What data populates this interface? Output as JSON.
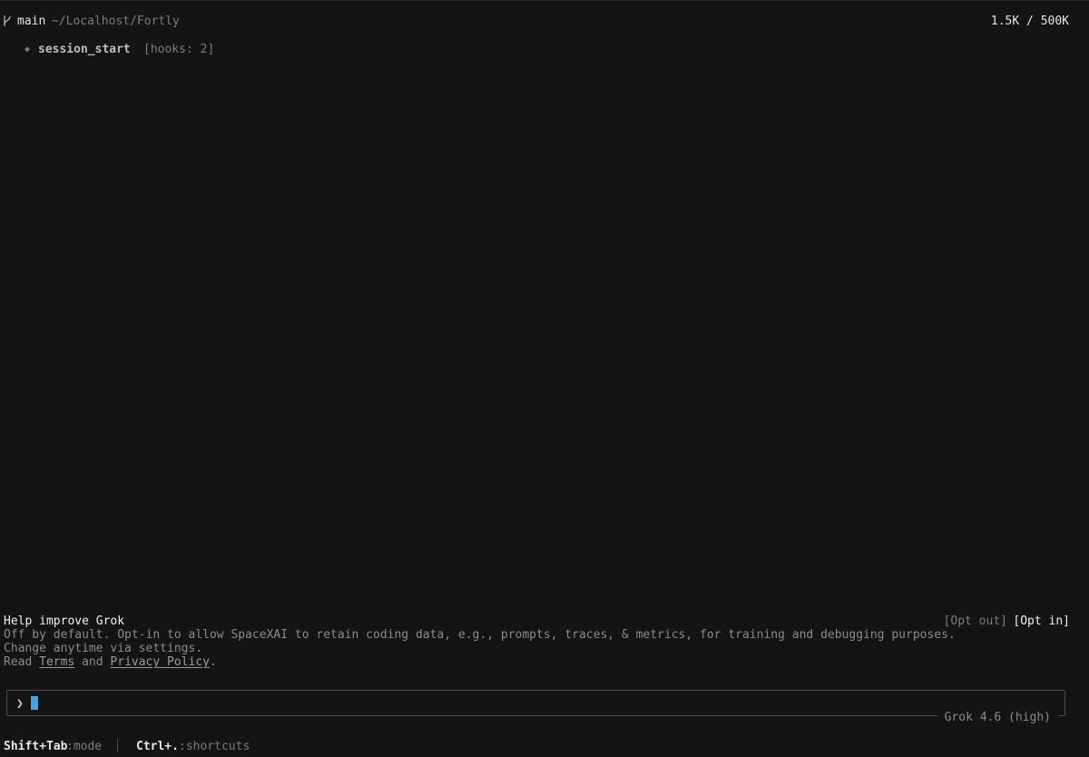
{
  "header": {
    "branch_icon": "git-branch-icon",
    "branch": "main",
    "path": "~/Localhost/Fortly",
    "tokens": "1.5K / 500K"
  },
  "session": {
    "icon": "diamond-icon",
    "name": "session_start",
    "hooks": "[hooks: 2]"
  },
  "help": {
    "title": "Help improve Grok",
    "line1": "Off by default. Opt-in to allow SpaceXAI to retain coding data, e.g., prompts, traces, & metrics, for training and debugging purposes.",
    "line2": "Change anytime via settings.",
    "read_prefix": "Read ",
    "terms": "Terms",
    "and": " and ",
    "privacy": "Privacy Policy",
    "period": ".",
    "opt_out": "[Opt out]",
    "opt_in": "[Opt in]"
  },
  "prompt": {
    "arrow": "❯",
    "value": "",
    "model": "Grok 4.6 (high)"
  },
  "footer": {
    "key1": "Shift+Tab",
    "desc1": ":mode",
    "key2": "Ctrl+.",
    "desc2": ":shortcuts"
  },
  "colors": {
    "background": "#141414",
    "cursor": "#4aa3df"
  }
}
